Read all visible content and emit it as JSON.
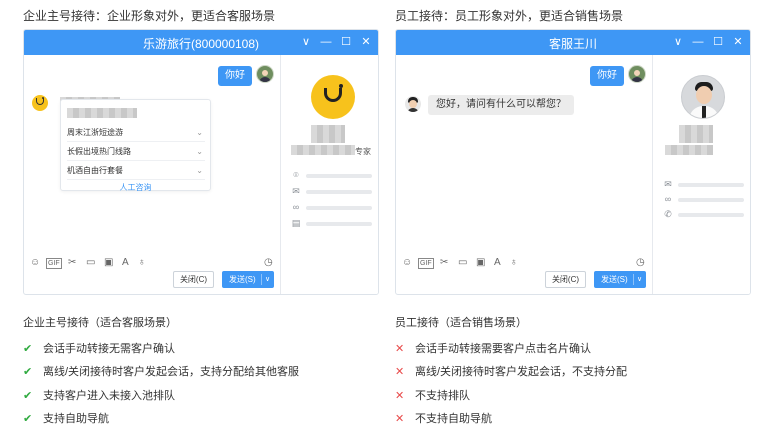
{
  "left": {
    "heading": "企业主号接待：企业形象对外，更适合客服场景",
    "window": {
      "title": "乐游旅行(800000108)",
      "controls": [
        "∨",
        "—",
        "☐",
        "✕"
      ],
      "greeting": "你好",
      "menu_items": [
        "周末江浙短途游",
        "长假出境热门线路",
        "机酒自由行套餐"
      ],
      "menu_link": "人工咨询",
      "side_text": "专家",
      "close_button": "关闭(C)",
      "send_button": "发送(S)"
    },
    "section_title": "企业主号接待（适合客服场景）",
    "features": [
      "会话手动转接无需客户确认",
      "离线/关闭接待时客户发起会话，支持分配给其他客服",
      "支持客户进入未接入池排队",
      "支持自助导航"
    ]
  },
  "right": {
    "heading": "员工接待：员工形象对外，更适合销售场景",
    "window": {
      "title": "客服王川",
      "controls": [
        "∨",
        "—",
        "☐",
        "✕"
      ],
      "greeting": "你好",
      "agent_message": "您好，请问有什么可以帮您？",
      "close_button": "关闭(C)",
      "send_button": "发送(S)"
    },
    "section_title": "员工接待（适合销售场景）",
    "features": [
      "会话手动转接需要客户点击名片确认",
      "离线/关闭接待时客户发起会话，不支持分配",
      "不支持排队",
      "不支持自助导航"
    ]
  },
  "icons": {
    "yes": "check-icon",
    "no": "cross-icon",
    "tools": [
      "emoji-icon",
      "gif-icon",
      "scissors-icon",
      "folder-icon",
      "image-icon",
      "font-icon",
      "microphone-icon"
    ],
    "history": "clock-icon",
    "contact": [
      "location-icon",
      "mail-icon",
      "link-icon",
      "building-icon"
    ]
  },
  "marks": {
    "yes": "✔",
    "no": "✕"
  },
  "colors": {
    "titlebar": "#3e97f5",
    "yes": "#2faa3f",
    "no": "#e84a4a"
  }
}
